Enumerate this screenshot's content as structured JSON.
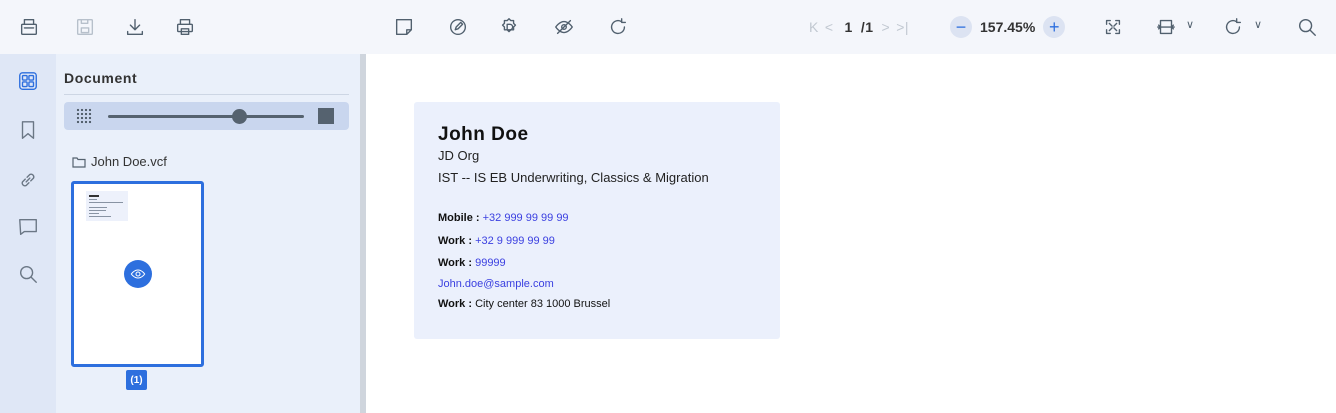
{
  "toolbar": {
    "left_icons": [
      "open-file-icon",
      "save-icon",
      "download-icon",
      "print-icon"
    ],
    "center_icons": [
      "sticky-note-icon",
      "edit-icon",
      "settings-icon",
      "hide-icon",
      "redo-icon"
    ],
    "pager": {
      "current": "1",
      "total": "/1"
    },
    "zoom": {
      "minus": "−",
      "value": "157.45%",
      "plus": "+"
    },
    "right_icons": [
      "fullscreen-icon",
      "fit-width-icon",
      "rotate-icon",
      "search-icon"
    ]
  },
  "rail": {
    "icons": [
      "thumbnails-icon",
      "bookmark-icon",
      "link-icon",
      "comment-icon",
      "search-icon"
    ]
  },
  "panel": {
    "title": "Document",
    "file_name": "John Doe.vcf",
    "page_badge": "(1)"
  },
  "card": {
    "name": "John Doe",
    "org": "JD Org",
    "title": "IST -- IS EB Underwriting, Classics & Migration",
    "lines": [
      {
        "label": "Mobile : ",
        "value": "+32 999 99 99 99",
        "link": true
      },
      {
        "label": "Work : ",
        "value": "+32 9 999 99 99",
        "link": true
      },
      {
        "label": "Work : ",
        "value": "99999",
        "link": true
      },
      {
        "label": "",
        "value": "John.doe@sample.com",
        "link": true
      },
      {
        "label": "Work : ",
        "value": "City center 83 1000 Brussel",
        "link": false
      }
    ]
  },
  "colors": {
    "accent": "#2d6fde",
    "link": "#3a3fe0",
    "card": "#ebf0fc"
  }
}
